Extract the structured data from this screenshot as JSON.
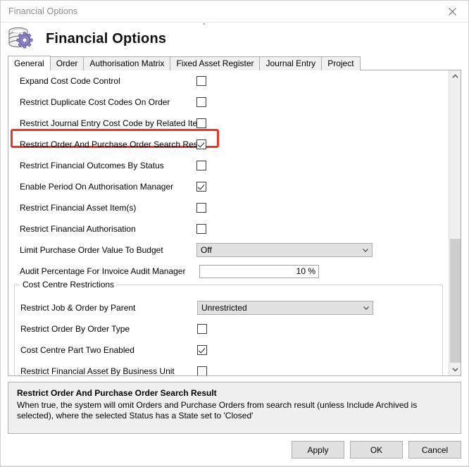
{
  "window": {
    "title": "Financial Options",
    "close_icon": "close-icon"
  },
  "header": {
    "icon": "database-settings-icon",
    "title": "Financial Options"
  },
  "tabs": [
    {
      "label": "General",
      "selected": true
    },
    {
      "label": "Order",
      "selected": false
    },
    {
      "label": "Authorisation Matrix",
      "selected": false
    },
    {
      "label": "Fixed Asset Register",
      "selected": false
    },
    {
      "label": "Journal Entry",
      "selected": false
    },
    {
      "label": "Project",
      "selected": false
    }
  ],
  "options": [
    {
      "label": "Expand Cost Code Control",
      "type": "checkbox",
      "checked": false
    },
    {
      "label": "Restrict Duplicate Cost Codes On Order",
      "type": "checkbox",
      "checked": false
    },
    {
      "label": "Restrict Journal Entry Cost Code by Related Item",
      "type": "checkbox",
      "checked": false
    },
    {
      "label": "Restrict Order And Purchase Order Search Result",
      "type": "checkbox",
      "checked": true,
      "highlighted": true
    },
    {
      "label": "Restrict Financial Outcomes By Status",
      "type": "checkbox",
      "checked": false
    },
    {
      "label": "Enable Period On Authorisation Manager",
      "type": "checkbox",
      "checked": true
    },
    {
      "label": "Restrict Financial Asset Item(s)",
      "type": "checkbox",
      "checked": false
    },
    {
      "label": "Restrict Financial Authorisation",
      "type": "checkbox",
      "checked": false
    },
    {
      "label": "Limit Purchase Order Value To Budget",
      "type": "combobox",
      "value": "Off"
    },
    {
      "label": "Audit Percentage For Invoice Audit Manager",
      "type": "number",
      "value": "10 %"
    }
  ],
  "group": {
    "legend": "Cost Centre Restrictions",
    "options": [
      {
        "label": "Restrict Job & Order by Parent",
        "type": "combobox",
        "value": "Unrestricted"
      },
      {
        "label": "Restrict Order By Order Type",
        "type": "checkbox",
        "checked": false
      },
      {
        "label": "Cost Centre Part Two Enabled",
        "type": "checkbox",
        "checked": true
      },
      {
        "label": "Restrict Financial Asset By Business Unit",
        "type": "checkbox",
        "checked": false
      }
    ]
  },
  "scrollbar": {
    "up_icon": "chevron-up-icon",
    "down_icon": "chevron-down-icon"
  },
  "description": {
    "title": "Restrict Order And Purchase Order Search Result",
    "text": "When true, the system will omit Orders and Purchase Orders from search result (unless Include Archived is selected), where the selected Status has a State set to 'Closed'"
  },
  "footer": {
    "buttons": [
      {
        "label": "Apply"
      },
      {
        "label": "OK"
      },
      {
        "label": "Cancel"
      }
    ]
  },
  "colors": {
    "highlight": "#ee3524",
    "combo_bg": "#e1e1e1",
    "panel_bg": "#f0f0f0"
  }
}
